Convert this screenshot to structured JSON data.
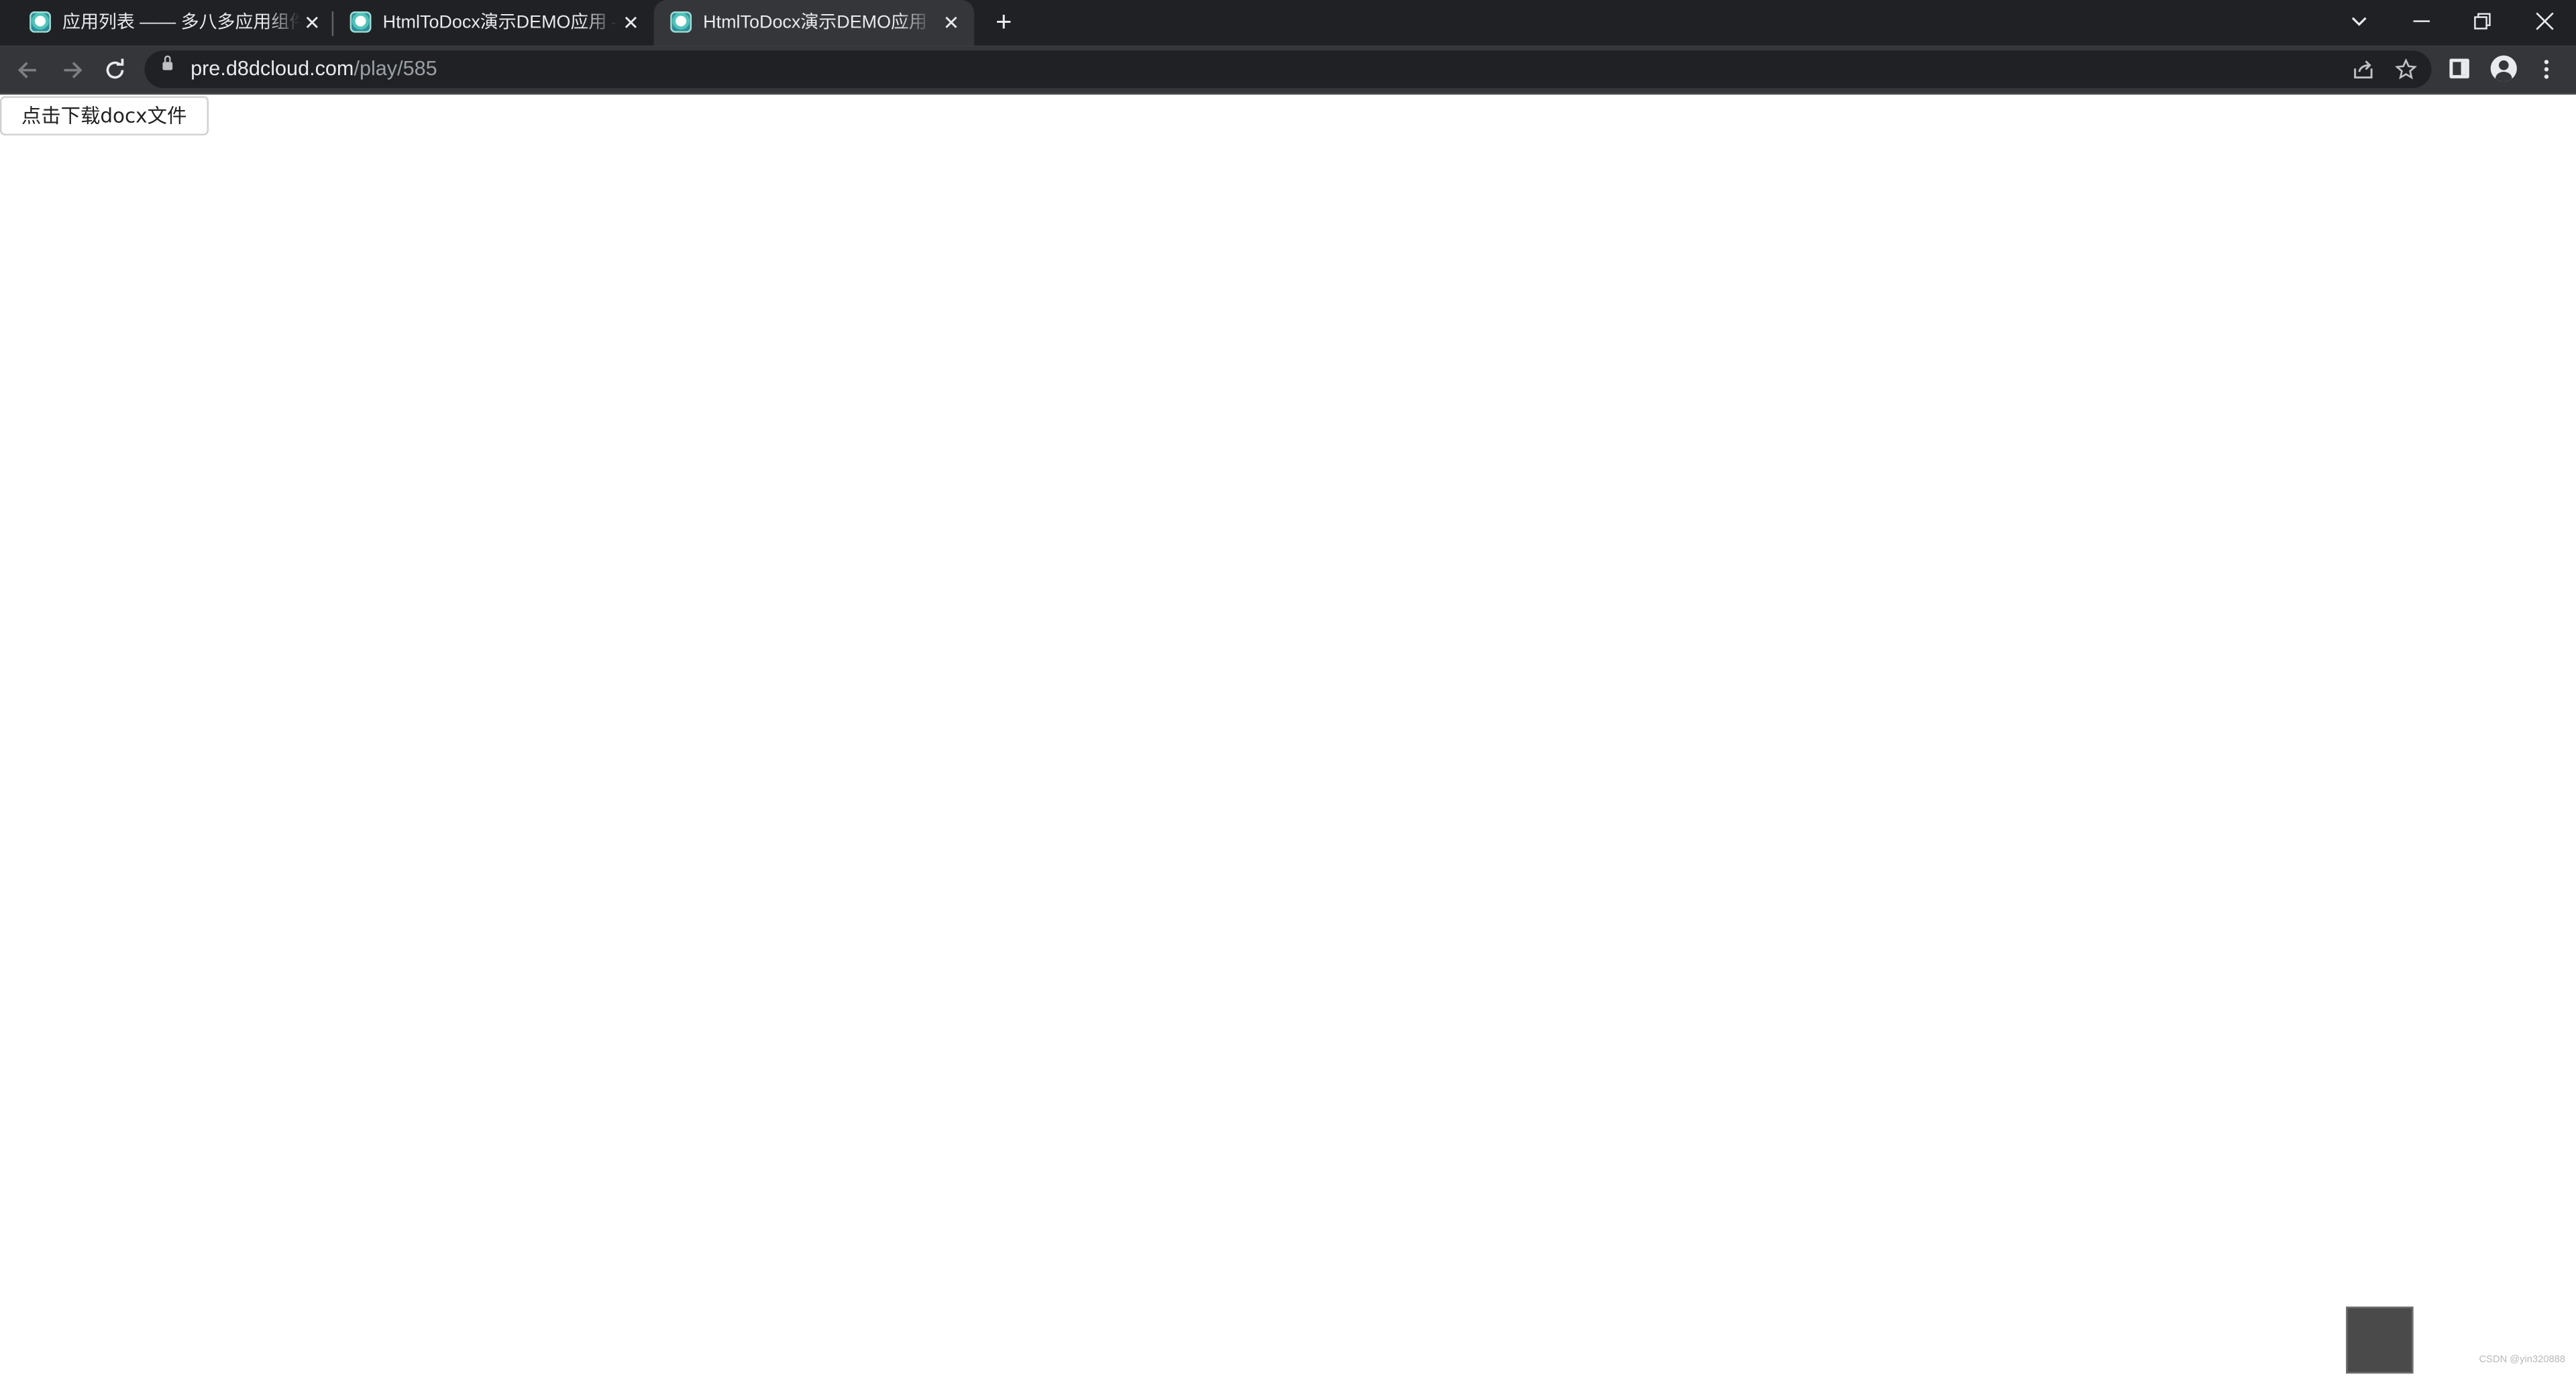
{
  "tabs": [
    {
      "title": "应用列表 —— 多八多应用组件商",
      "active": false
    },
    {
      "title": "HtmlToDocx演示DEMO应用 —",
      "active": false
    },
    {
      "title": "HtmlToDocx演示DEMO应用",
      "active": true
    }
  ],
  "toolbar": {
    "url_host": "pre.d8dcloud.com",
    "url_path": "/play/585"
  },
  "page": {
    "download_button_label": "点击下载docx文件",
    "watermark": "CSDN @yin320888"
  },
  "icons": {
    "close": "close-icon",
    "new_tab": "plus-icon",
    "back": "back-arrow-icon",
    "forward": "forward-arrow-icon",
    "reload": "reload-icon",
    "lock": "lock-icon",
    "share": "share-icon",
    "star": "star-icon",
    "side_panel": "side-panel-icon",
    "profile": "profile-icon",
    "menu": "kebab-menu-icon"
  },
  "colors": {
    "tabstrip_bg": "#202124",
    "toolbar_bg": "#35363a",
    "page_bg": "#ffffff",
    "floating_square": "#4a4a4a"
  }
}
